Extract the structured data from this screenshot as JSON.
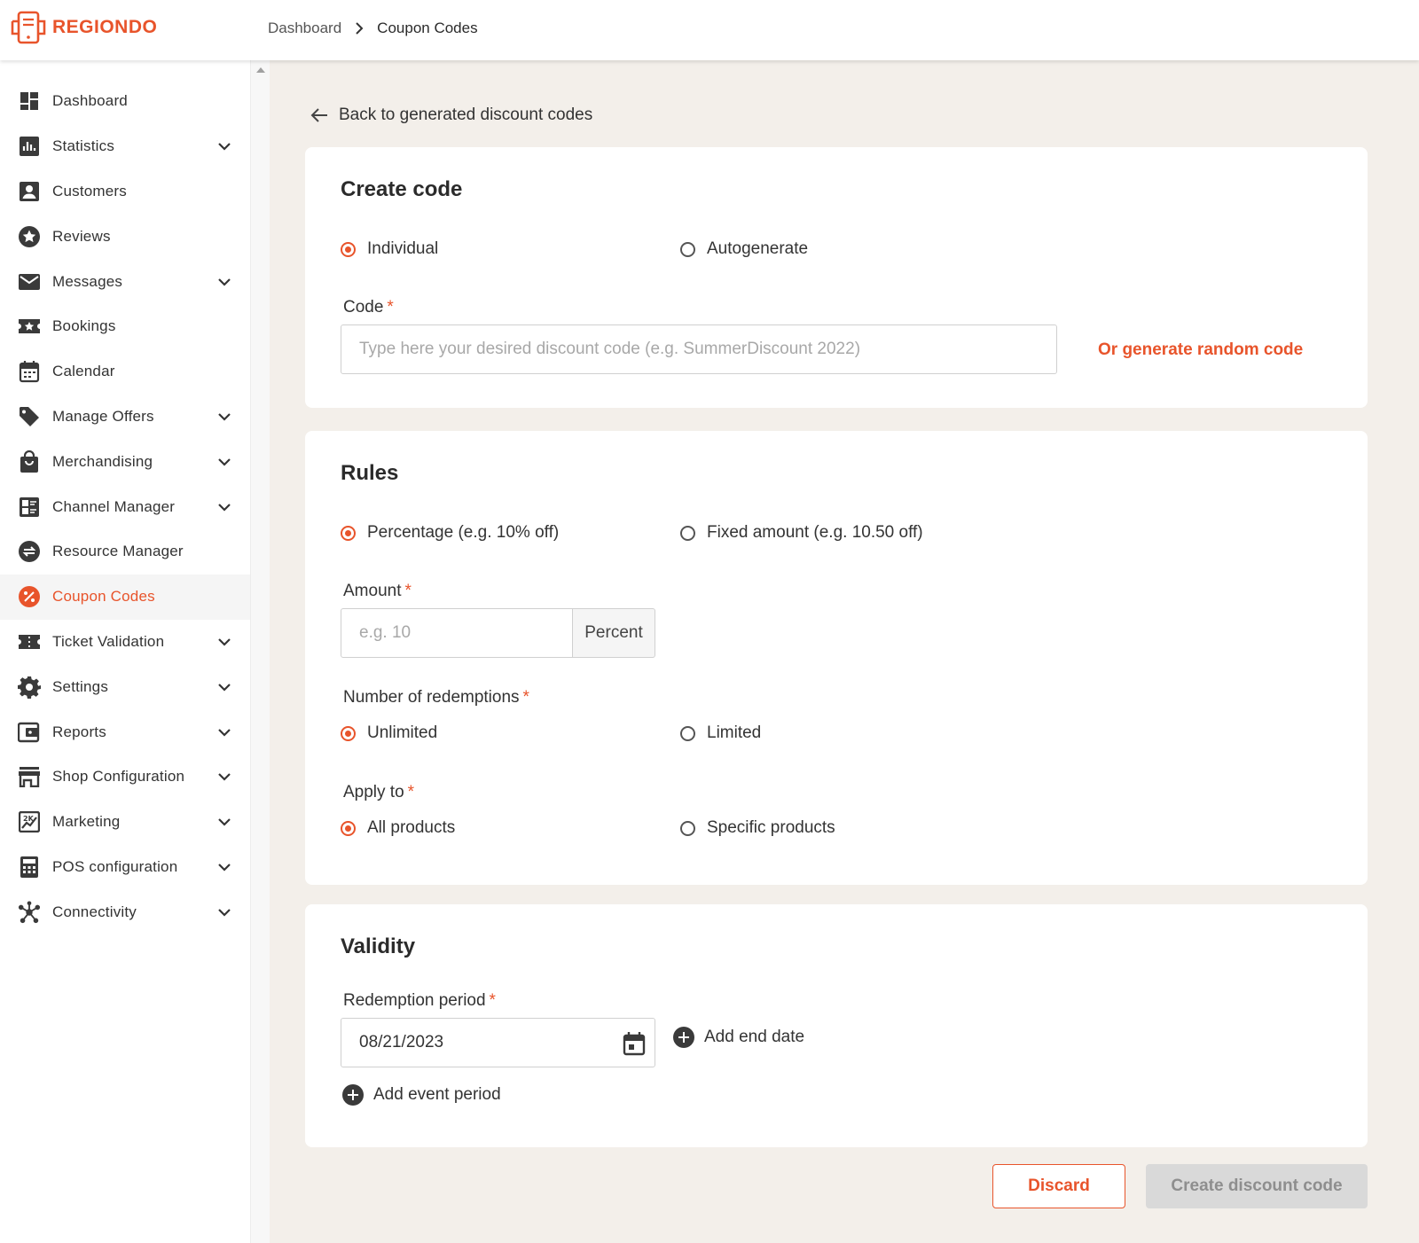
{
  "brand": {
    "name": "REGIONDO",
    "color": "#e8542b"
  },
  "breadcrumb": {
    "items": [
      "Dashboard",
      "Coupon Codes"
    ]
  },
  "sidebar": {
    "items": [
      {
        "label": "Dashboard",
        "icon": "dashboard-icon",
        "expandable": false
      },
      {
        "label": "Statistics",
        "icon": "bar-chart-icon",
        "expandable": true
      },
      {
        "label": "Customers",
        "icon": "person-icon",
        "expandable": false
      },
      {
        "label": "Reviews",
        "icon": "star-icon",
        "expandable": false
      },
      {
        "label": "Messages",
        "icon": "mail-icon",
        "expandable": true
      },
      {
        "label": "Bookings",
        "icon": "ticket-star-icon",
        "expandable": false
      },
      {
        "label": "Calendar",
        "icon": "calendar-icon",
        "expandable": false
      },
      {
        "label": "Manage Offers",
        "icon": "tag-icon",
        "expandable": true
      },
      {
        "label": "Merchandising",
        "icon": "shopping-bag-icon",
        "expandable": true
      },
      {
        "label": "Channel Manager",
        "icon": "channels-icon",
        "expandable": true
      },
      {
        "label": "Resource Manager",
        "icon": "swap-icon",
        "expandable": false
      },
      {
        "label": "Coupon Codes",
        "icon": "percent-badge-icon",
        "expandable": false,
        "active": true
      },
      {
        "label": "Ticket Validation",
        "icon": "ticket-icon",
        "expandable": true
      },
      {
        "label": "Settings",
        "icon": "gear-icon",
        "expandable": true
      },
      {
        "label": "Reports",
        "icon": "wallet-icon",
        "expandable": true
      },
      {
        "label": "Shop Configuration",
        "icon": "store-icon",
        "expandable": true
      },
      {
        "label": "Marketing",
        "icon": "marketing-icon",
        "expandable": true
      },
      {
        "label": "POS configuration",
        "icon": "calculator-icon",
        "expandable": true
      },
      {
        "label": "Connectivity",
        "icon": "hub-icon",
        "expandable": true
      }
    ]
  },
  "main": {
    "back_label": "Back to generated discount codes",
    "create_code": {
      "title": "Create code",
      "options": [
        "Individual",
        "Autogenerate"
      ],
      "selected": "Individual",
      "code_label": "Code",
      "code_placeholder": "Type here your desired discount code (e.g. SummerDiscount 2022)",
      "code_value": "",
      "generate_label": "Or generate random code"
    },
    "rules": {
      "title": "Rules",
      "type_options": [
        "Percentage (e.g. 10% off)",
        "Fixed amount (e.g. 10.50 off)"
      ],
      "type_selected": "Percentage (e.g. 10% off)",
      "amount_label": "Amount",
      "amount_placeholder": "e.g. 10",
      "amount_unit": "Percent",
      "redemptions_label": "Number of redemptions",
      "redemptions_options": [
        "Unlimited",
        "Limited"
      ],
      "redemptions_selected": "Unlimited",
      "apply_label": "Apply to",
      "apply_options": [
        "All products",
        "Specific products"
      ],
      "apply_selected": "All products"
    },
    "validity": {
      "title": "Validity",
      "period_label": "Redemption period",
      "start_date": "08/21/2023",
      "add_end_date": "Add end date",
      "add_event_period": "Add event period"
    },
    "actions": {
      "discard": "Discard",
      "create": "Create discount code"
    }
  },
  "required_mark": "*"
}
